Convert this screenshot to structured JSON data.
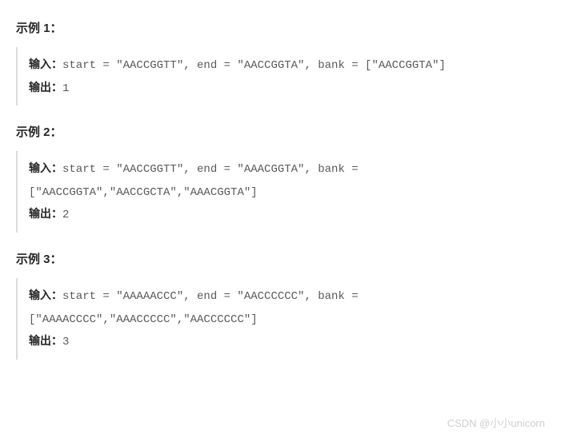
{
  "examples": [
    {
      "heading": "示例 1：",
      "input_label": "输入：",
      "input_code": "start = \"AACCGGTT\", end = \"AACCGGTA\", bank = [\"AACCGGTA\"]",
      "output_label": "输出：",
      "output_value": "1"
    },
    {
      "heading": "示例 2：",
      "input_label": "输入：",
      "input_code": "start = \"AACCGGTT\", end = \"AAACGGTA\", bank = [\"AACCGGTA\",\"AACCGCTA\",\"AAACGGTA\"]",
      "output_label": "输出：",
      "output_value": "2"
    },
    {
      "heading": "示例 3：",
      "input_label": "输入：",
      "input_code": "start = \"AAAAACCC\", end = \"AACCCCCC\", bank = [\"AAAACCCC\",\"AAACCCCC\",\"AACCCCCC\"]",
      "output_label": "输出：",
      "output_value": "3"
    }
  ],
  "watermark": "CSDN @小小unicorn"
}
